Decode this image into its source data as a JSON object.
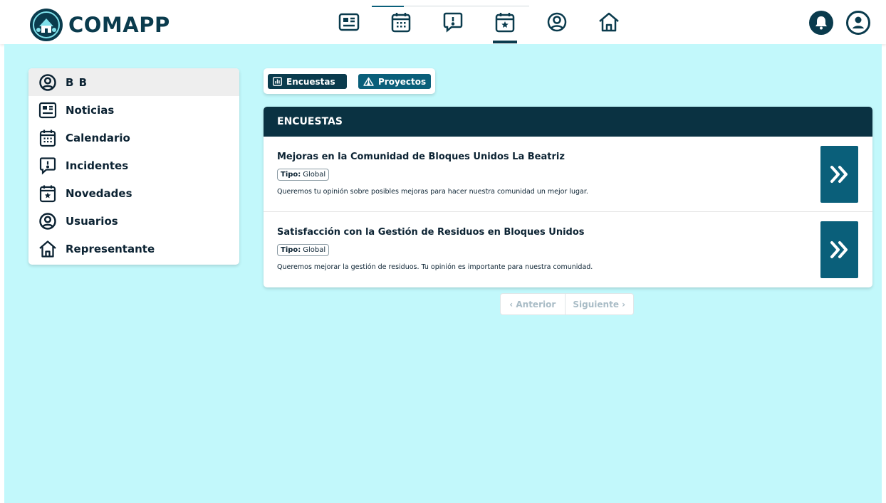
{
  "app": {
    "name": "COMAPP"
  },
  "topnav": {
    "items": [
      {
        "icon": "newspaper-icon"
      },
      {
        "icon": "calendar-icon"
      },
      {
        "icon": "message-alert-icon"
      },
      {
        "icon": "calendar-star-icon",
        "active": true
      },
      {
        "icon": "user-circle-icon"
      },
      {
        "icon": "home-icon"
      }
    ]
  },
  "header_right": {
    "notifications_icon": "bell-icon",
    "profile_icon": "user-circle-icon"
  },
  "sidebar": {
    "user": "B B",
    "items": [
      {
        "label": "Noticias",
        "icon": "newspaper-icon"
      },
      {
        "label": "Calendario",
        "icon": "calendar-icon"
      },
      {
        "label": "Incidentes",
        "icon": "message-alert-icon"
      },
      {
        "label": "Novedades",
        "icon": "calendar-star-icon"
      },
      {
        "label": "Usuarios",
        "icon": "user-circle-icon"
      },
      {
        "label": "Representante",
        "icon": "home-icon"
      }
    ]
  },
  "tabs": [
    {
      "label": "Encuestas",
      "icon": "bar-chart-icon",
      "selected": true
    },
    {
      "label": "Proyectos",
      "icon": "tent-icon",
      "selected": false
    }
  ],
  "panel": {
    "title": "ENCUESTAS",
    "surveys": [
      {
        "title": "Mejoras en la Comunidad de Bloques Unidos La Beatriz",
        "type_label": "Tipo:",
        "type_value": "Global",
        "description": "Queremos tu opinión sobre posibles mejoras para hacer nuestra comunidad un mejor lugar."
      },
      {
        "title": "Satisfacción con la Gestión de Residuos en Bloques Unidos",
        "type_label": "Tipo:",
        "type_value": "Global",
        "description": "Queremos mejorar la gestión de residuos. Tu opinión es importante para nuestra comunidad."
      }
    ]
  },
  "pagination": {
    "prev_label": "‹ Anterior",
    "next_label": "Siguiente ›"
  },
  "colors": {
    "primary": "#0a3b4d",
    "accent": "#0a5f7a",
    "background": "#c2f8fb",
    "panel_header": "#0a3242"
  }
}
